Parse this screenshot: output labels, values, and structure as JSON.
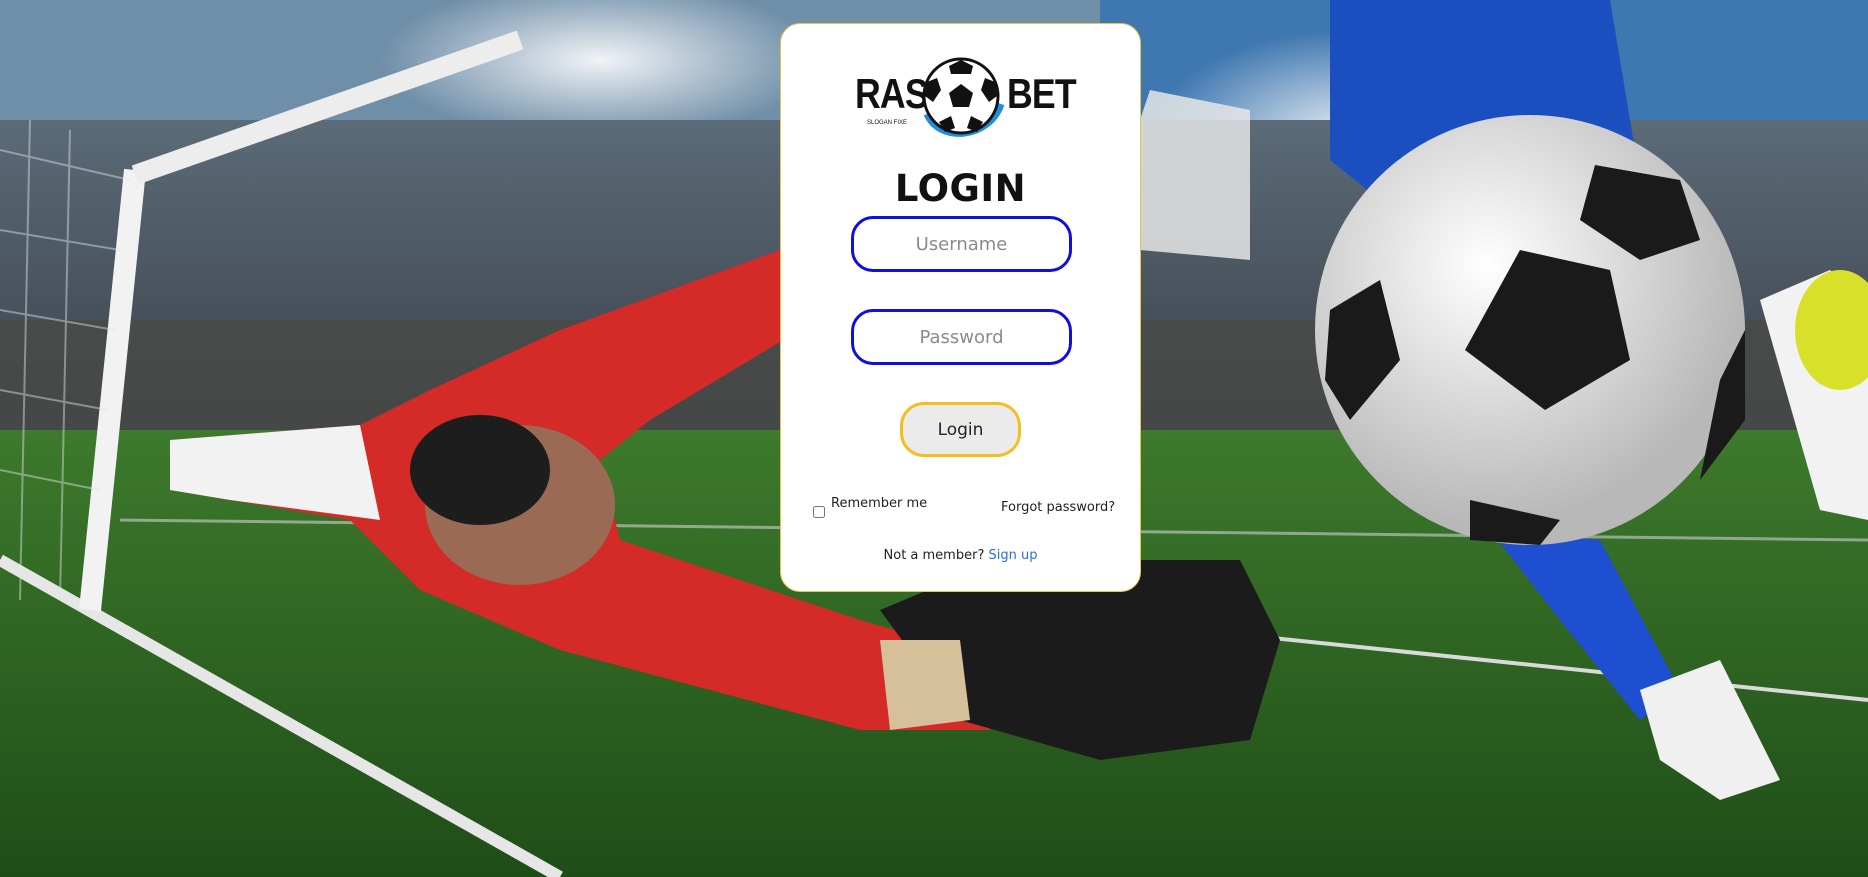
{
  "brand": {
    "name_left": "RAS",
    "name_right": "BET",
    "slogan": "SLOGAN FIXE"
  },
  "form": {
    "title": "LOGIN",
    "username_placeholder": "Username",
    "password_placeholder": "Password",
    "login_label": "Login",
    "remember_label": "Remember me",
    "forgot_label": "Forgot password?",
    "not_member_text": "Not a member?",
    "signup_label": "Sign up"
  },
  "colors": {
    "input_border": "#1010d8",
    "button_border": "#f5bd22",
    "link": "#2b6fd8"
  }
}
